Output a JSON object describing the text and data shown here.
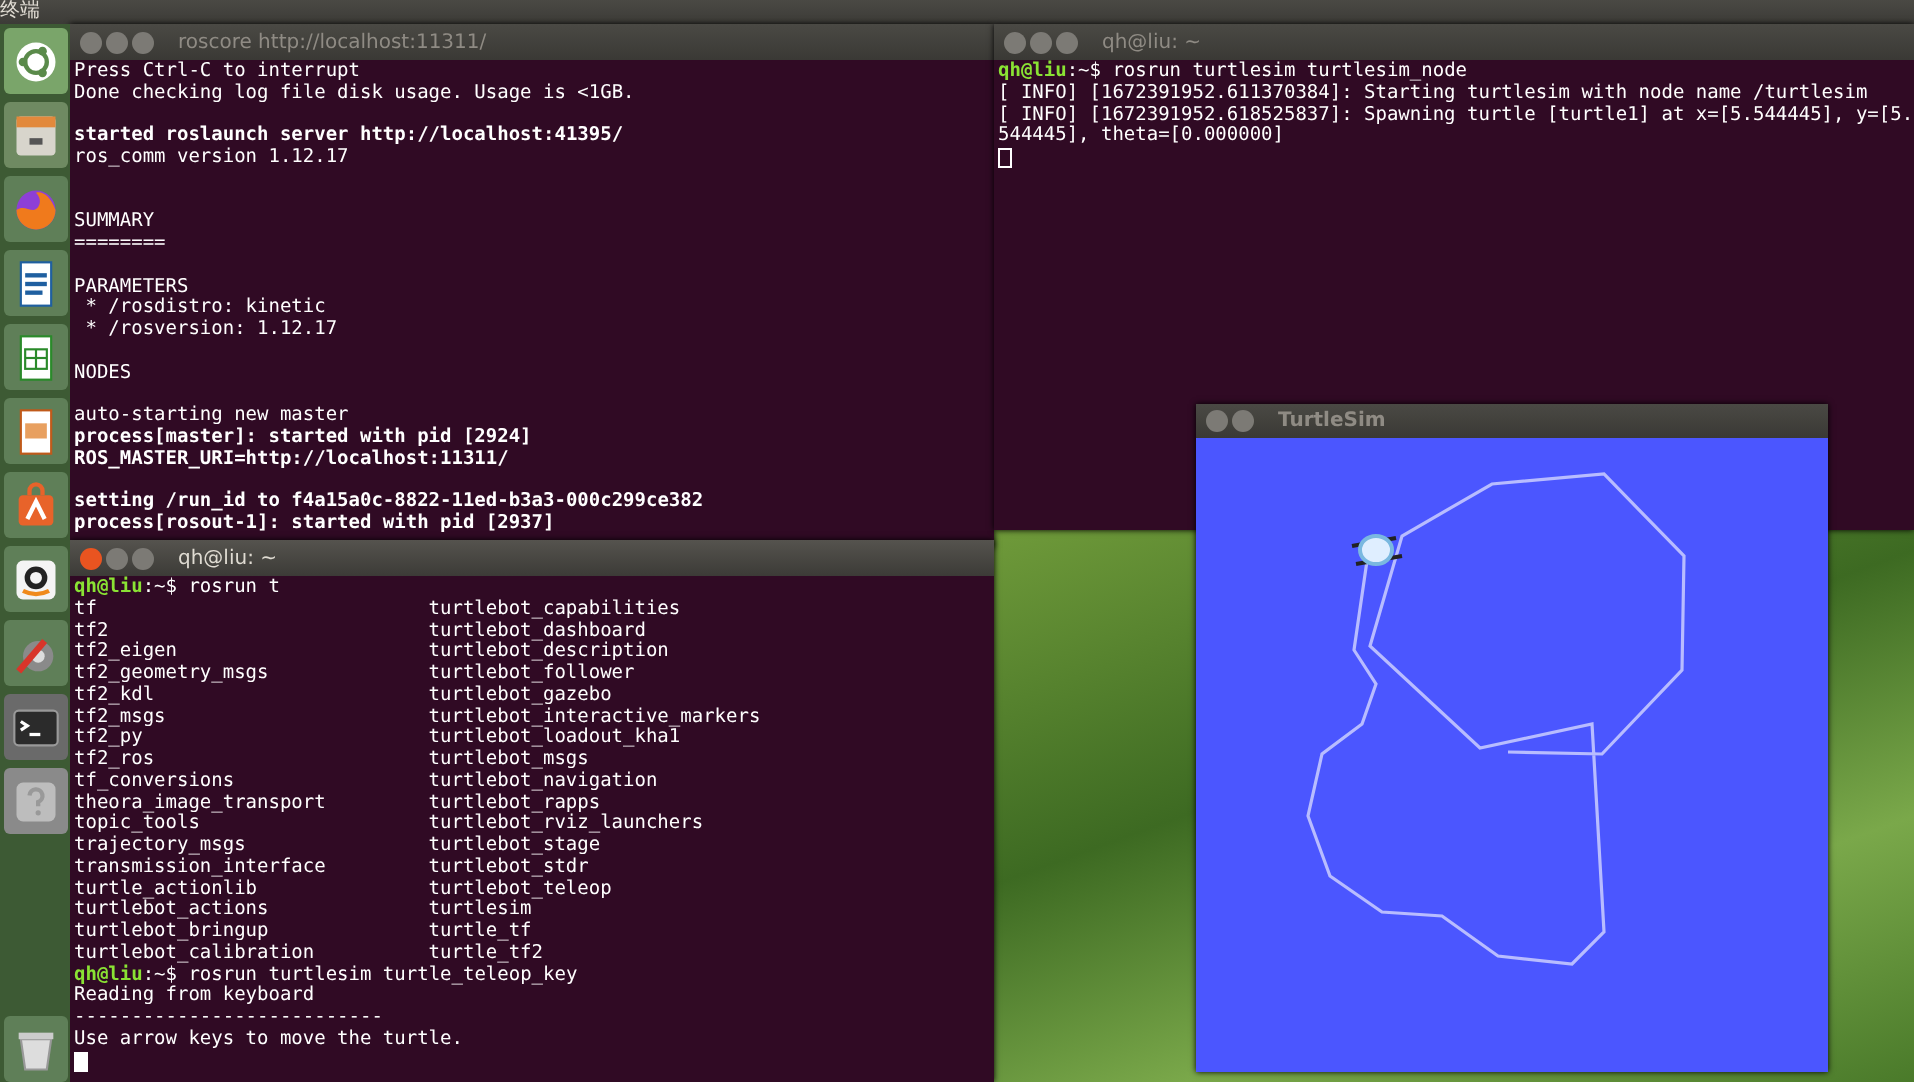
{
  "top_panel": {
    "title": "终端"
  },
  "launcher": {
    "items": [
      {
        "kind": "dash"
      },
      {
        "kind": "files"
      },
      {
        "kind": "browser"
      },
      {
        "kind": "writer"
      },
      {
        "kind": "calc"
      },
      {
        "kind": "impress"
      },
      {
        "kind": "store"
      },
      {
        "kind": "amazon"
      },
      {
        "kind": "settings"
      },
      {
        "kind": "terminal"
      },
      {
        "kind": "help"
      },
      {
        "kind": "trash"
      }
    ]
  },
  "windows": [
    {
      "kind": "terminal",
      "title": "roscore http://localhost:11311/",
      "focused": false,
      "lines": [
        {
          "kind": "text",
          "text": "Press Ctrl-C to interrupt",
          "bold": false
        },
        {
          "kind": "text",
          "text": "Done checking log file disk usage. Usage is <1GB.",
          "bold": false
        },
        {
          "kind": "blank"
        },
        {
          "kind": "text",
          "text": "started roslaunch server http://localhost:41395/",
          "bold": true
        },
        {
          "kind": "text",
          "text": "ros_comm version 1.12.17",
          "bold": false
        },
        {
          "kind": "blank"
        },
        {
          "kind": "blank"
        },
        {
          "kind": "text",
          "text": "SUMMARY",
          "bold": false
        },
        {
          "kind": "text",
          "text": "========",
          "bold": false
        },
        {
          "kind": "blank"
        },
        {
          "kind": "text",
          "text": "PARAMETERS",
          "bold": false
        },
        {
          "kind": "text",
          "text": " * /rosdistro: kinetic",
          "bold": false
        },
        {
          "kind": "text",
          "text": " * /rosversion: 1.12.17",
          "bold": false
        },
        {
          "kind": "blank"
        },
        {
          "kind": "text",
          "text": "NODES",
          "bold": false
        },
        {
          "kind": "blank"
        },
        {
          "kind": "text",
          "text": "auto-starting new master",
          "bold": false
        },
        {
          "kind": "text",
          "text": "process[master]: started with pid [2924]",
          "bold": true
        },
        {
          "kind": "text",
          "text": "ROS_MASTER_URI=http://localhost:11311/",
          "bold": true
        },
        {
          "kind": "blank"
        },
        {
          "kind": "text",
          "text": "setting /run_id to f4a15a0c-8822-11ed-b3a3-000c299ce382",
          "bold": true
        },
        {
          "kind": "text",
          "text": "process[rosout-1]: started with pid [2937]",
          "bold": true
        }
      ]
    },
    {
      "kind": "terminal",
      "title": "qh@liu: ~",
      "focused": false,
      "lines": [
        {
          "kind": "prompt",
          "user": "qh@liu",
          "text": ":~$ rosrun turtlesim turtlesim_node"
        },
        {
          "kind": "text",
          "text": "[ INFO] [1672391952.611370384]: Starting turtlesim with node name /turtlesim",
          "bold": false
        },
        {
          "kind": "text",
          "text": "[ INFO] [1672391952.618525837]: Spawning turtle [turtle1] at x=[5.544445], y=[5.",
          "bold": false
        },
        {
          "kind": "text",
          "text": "544445], theta=[0.000000]",
          "bold": false
        },
        {
          "kind": "cursor"
        }
      ]
    },
    {
      "kind": "wallpaper"
    },
    {
      "kind": "terminal",
      "title": "qh@liu: ~",
      "focused": true,
      "lines": [
        {
          "kind": "prompt",
          "user": "qh@liu",
          "text": ":~$ rosrun t"
        },
        {
          "kind": "columns",
          "columns": [
            "tf",
            "turtlebot_capabilities"
          ]
        },
        {
          "kind": "columns",
          "columns": [
            "tf2",
            "turtlebot_dashboard"
          ]
        },
        {
          "kind": "columns",
          "columns": [
            "tf2_eigen",
            "turtlebot_description"
          ]
        },
        {
          "kind": "columns",
          "columns": [
            "tf2_geometry_msgs",
            "turtlebot_follower"
          ]
        },
        {
          "kind": "columns",
          "columns": [
            "tf2_kdl",
            "turtlebot_gazebo"
          ]
        },
        {
          "kind": "columns",
          "columns": [
            "tf2_msgs",
            "turtlebot_interactive_markers"
          ]
        },
        {
          "kind": "columns",
          "columns": [
            "tf2_py",
            "turtlebot_loadout_kha1"
          ]
        },
        {
          "kind": "columns",
          "columns": [
            "tf2_ros",
            "turtlebot_msgs"
          ]
        },
        {
          "kind": "columns",
          "columns": [
            "tf_conversions",
            "turtlebot_navigation"
          ]
        },
        {
          "kind": "columns",
          "columns": [
            "theora_image_transport",
            "turtlebot_rapps"
          ]
        },
        {
          "kind": "columns",
          "columns": [
            "topic_tools",
            "turtlebot_rviz_launchers"
          ]
        },
        {
          "kind": "columns",
          "columns": [
            "trajectory_msgs",
            "turtlebot_stage"
          ]
        },
        {
          "kind": "columns",
          "columns": [
            "transmission_interface",
            "turtlebot_stdr"
          ]
        },
        {
          "kind": "columns",
          "columns": [
            "turtle_actionlib",
            "turtlebot_teleop"
          ]
        },
        {
          "kind": "columns",
          "columns": [
            "turtlebot_actions",
            "turtlesim"
          ]
        },
        {
          "kind": "columns",
          "columns": [
            "turtlebot_bringup",
            "turtle_tf"
          ]
        },
        {
          "kind": "columns",
          "columns": [
            "turtlebot_calibration",
            "turtle_tf2"
          ]
        },
        {
          "kind": "prompt",
          "user": "qh@liu",
          "text": ":~$ rosrun turtlesim turtle_teleop_key"
        },
        {
          "kind": "text",
          "text": "Reading from keyboard",
          "bold": false
        },
        {
          "kind": "text",
          "text": "---------------------------",
          "bold": false
        },
        {
          "kind": "text",
          "text": "Use arrow keys to move the turtle.",
          "bold": false
        },
        {
          "kind": "cursor"
        }
      ]
    },
    {
      "kind": "turtlesim",
      "title": "TurtleSim",
      "focused": false
    }
  ]
}
